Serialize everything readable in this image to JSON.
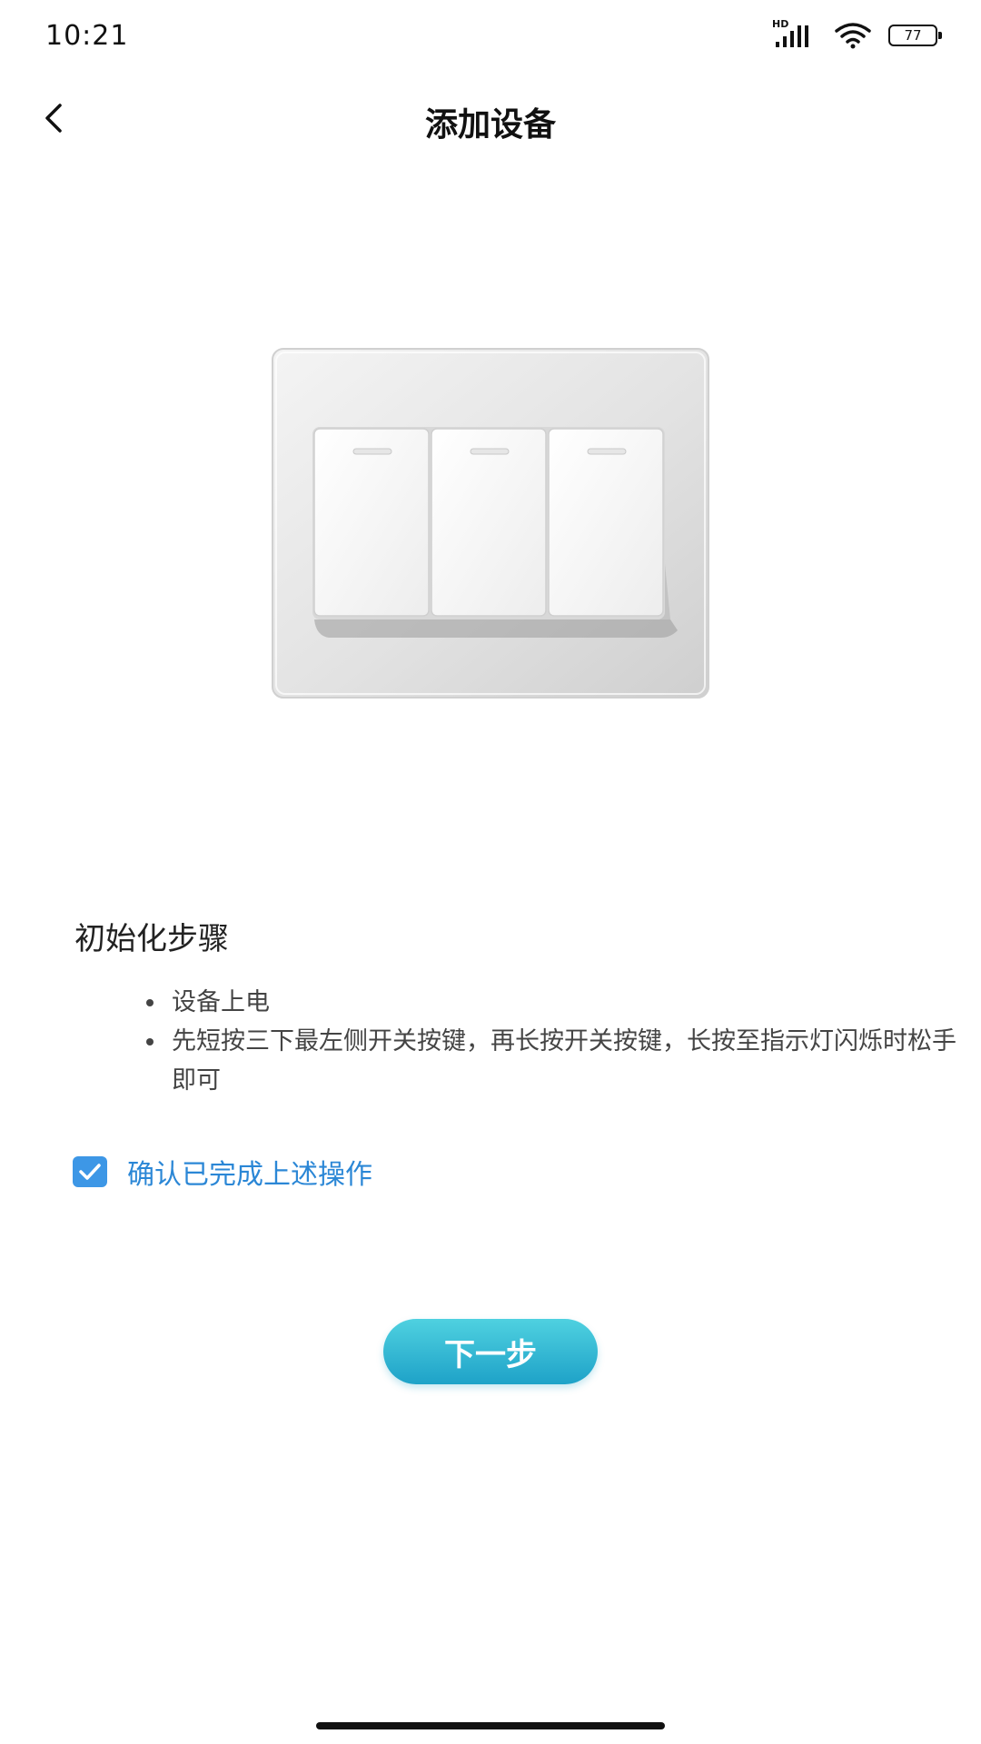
{
  "status_bar": {
    "time": "10:21",
    "hd_label": "HD",
    "battery": "77"
  },
  "header": {
    "title": "添加设备"
  },
  "instructions": {
    "section_title": "初始化步骤",
    "steps": [
      "设备上电",
      "先短按三下最左侧开关按键，再长按开关按键，长按至指示灯闪烁时松手即可"
    ]
  },
  "confirm": {
    "checked": true,
    "label": "确认已完成上述操作"
  },
  "next_button": {
    "label": "下一步"
  },
  "colors": {
    "accent": "#3d97e6",
    "confirm_text": "#2b87d6",
    "button_top": "#4fd1e0",
    "button_bottom": "#1ea2c8"
  }
}
